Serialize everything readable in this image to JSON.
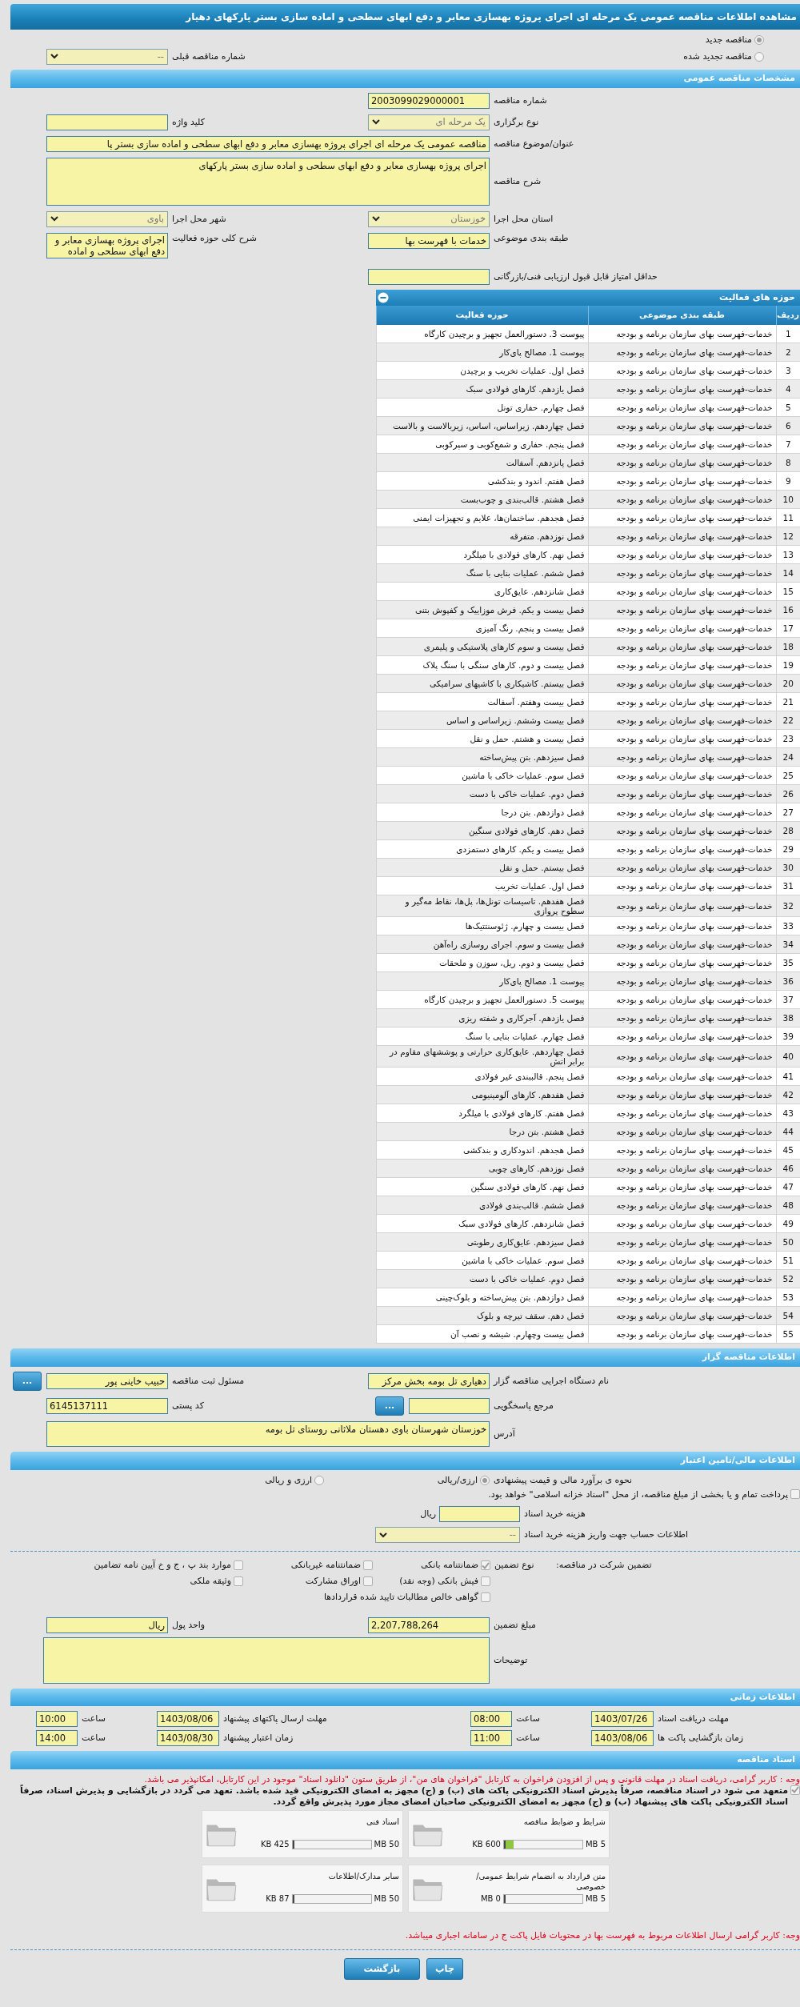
{
  "title": "مشاهده اطلاعات مناقصه عمومی یک مرحله ای اجرای پروژه بهسازی معابر و دفع ابهای سطحی و اماده سازی بستر پارکهای دهیار",
  "tender_kind": [
    {
      "label": "مناقصه جدید",
      "selected": true
    },
    {
      "label": "مناقصه تجدید شده",
      "selected": false
    }
  ],
  "previous_tender": {
    "label": "شماره مناقصه قبلی",
    "value": "--"
  },
  "general": {
    "header": "مشخصات مناقصه عمومی",
    "tender_number": {
      "label": "شماره مناقصه",
      "value": "2003099029000001"
    },
    "holding_type": {
      "label": "نوع برگزاری",
      "value": "یک مرحله ای"
    },
    "keyword": {
      "label": "کلید واژه"
    },
    "subject": {
      "label": "عنوان/موضوع مناقصه",
      "value": "مناقصه عمومی یک مرحله ای اجرای پروژه بهسازی معابر و دفع ابهای سطحی و اماده سازی بستر پا"
    },
    "description": {
      "label": "شرح مناقصه",
      "value": "اجرای پروژه بهسازی معابر و دفع ابهای سطحی و اماده سازی بستر پارکهای"
    },
    "province": {
      "label": "استان محل اجرا",
      "value": "خوزستان"
    },
    "city": {
      "label": "شهر محل اجرا",
      "value": "باوی"
    },
    "category": {
      "label": "طبقه بندی موضوعی",
      "value": "خدمات با فهرست بها"
    },
    "activity_summary": {
      "label": "شرح کلی حوزه فعالیت",
      "value": "اجرای پروژه بهسازی معابر و دفع ابهای سطحی و اماده"
    },
    "min_score": {
      "label": "حداقل امتیاز قابل قبول ارزیابی فنی/بازرگانی"
    }
  },
  "activities": {
    "header": "حوزه های فعالیت",
    "columns": [
      "ردیف",
      "طبقه بندی موضوعی",
      "حوزه فعالیت"
    ],
    "rows": [
      [
        "1",
        "خدمات-فهرست بهای سازمان برنامه و بودجه",
        "پیوست 3. دستورالعمل تجهیز و برچیدن کارگاه"
      ],
      [
        "2",
        "خدمات-فهرست بهای سازمان برنامه و بودجه",
        "پیوست 1. مصالح پای‌کار"
      ],
      [
        "3",
        "خدمات-فهرست بهای سازمان برنامه و بودجه",
        "فصل اول. عملیات تخریب و برچیدن"
      ],
      [
        "4",
        "خدمات-فهرست بهای سازمان برنامه و بودجه",
        "فصل یازدهم. کارهای فولادی سبک"
      ],
      [
        "5",
        "خدمات-فهرست بهای سازمان برنامه و بودجه",
        "فصل چهارم. حفاری تونل"
      ],
      [
        "6",
        "خدمات-فهرست بهای سازمان برنامه و بودجه",
        "فصل چهاردهم. زیراساس، اساس، زیربالاست و بالاست"
      ],
      [
        "7",
        "خدمات-فهرست بهای سازمان برنامه و بودجه",
        "فصل پنجم. حفاری و شمع‌کوبی و سپرکوبی"
      ],
      [
        "8",
        "خدمات-فهرست بهای سازمان برنامه و بودجه",
        "فصل پانزدهم. آسفالت"
      ],
      [
        "9",
        "خدمات-فهرست بهای سازمان برنامه و بودجه",
        "فصل هفتم. اندود و بندکشی"
      ],
      [
        "10",
        "خدمات-فهرست بهای سازمان برنامه و بودجه",
        "فصل هشتم. قالب‌بندی و چوب‌بست"
      ],
      [
        "11",
        "خدمات-فهرست بهای سازمان برنامه و بودجه",
        "فصل هجدهم. ساختمان‌ها، علایم و تجهیزات ایمنی"
      ],
      [
        "12",
        "خدمات-فهرست بهای سازمان برنامه و بودجه",
        "فصل نوزدهم. متفرقه"
      ],
      [
        "13",
        "خدمات-فهرست بهای سازمان برنامه و بودجه",
        "فصل نهم. کارهای فولادی با میلگرد"
      ],
      [
        "14",
        "خدمات-فهرست بهای سازمان برنامه و بودجه",
        "فصل ششم. عملیات بنایی با سنگ"
      ],
      [
        "15",
        "خدمات-فهرست بهای سازمان برنامه و بودجه",
        "فصل شانزدهم. عایق‌کاری"
      ],
      [
        "16",
        "خدمات-فهرست بهای سازمان برنامه و بودجه",
        "فصل بیست و یکم. فرش موزاییک و کفپوش بتنی"
      ],
      [
        "17",
        "خدمات-فهرست بهای سازمان برنامه و بودجه",
        "فصل بیست و پنجم. رنگ آمیزی"
      ],
      [
        "18",
        "خدمات-فهرست بهای سازمان برنامه و بودجه",
        "فصل بیست و سوم کارهای پلاستیکی و پلیمری"
      ],
      [
        "19",
        "خدمات-فهرست بهای سازمان برنامه و بودجه",
        "فصل بیست و دوم. کارهای سنگی با سنگ پلاک"
      ],
      [
        "20",
        "خدمات-فهرست بهای سازمان برنامه و بودجه",
        "فصل بیستم. کاشیکاری با کاشیهای سرامیکی"
      ],
      [
        "21",
        "خدمات-فهرست بهای سازمان برنامه و بودجه",
        "فصل بیست وهفتم. آسفالت"
      ],
      [
        "22",
        "خدمات-فهرست بهای سازمان برنامه و بودجه",
        "فصل بیست وششم. زیراساس و اساس"
      ],
      [
        "23",
        "خدمات-فهرست بهای سازمان برنامه و بودجه",
        "فصل بیست و هشتم. حمل و نقل"
      ],
      [
        "24",
        "خدمات-فهرست بهای سازمان برنامه و بودجه",
        "فصل سیزدهم. بتن پیش‌ساخته"
      ],
      [
        "25",
        "خدمات-فهرست بهای سازمان برنامه و بودجه",
        "فصل سوم. عملیات خاکی با ماشین"
      ],
      [
        "26",
        "خدمات-فهرست بهای سازمان برنامه و بودجه",
        "فصل دوم. عملیات خاکی با دست"
      ],
      [
        "27",
        "خدمات-فهرست بهای سازمان برنامه و بودجه",
        "فصل دوازدهم. بتن درجا"
      ],
      [
        "28",
        "خدمات-فهرست بهای سازمان برنامه و بودجه",
        "فصل دهم. کارهای فولادی سنگین"
      ],
      [
        "29",
        "خدمات-فهرست بهای سازمان برنامه و بودجه",
        "فصل بیست و یکم. کارهای دستمزدی"
      ],
      [
        "30",
        "خدمات-فهرست بهای سازمان برنامه و بودجه",
        "فصل بیستم. حمل و نقل"
      ],
      [
        "31",
        "خدمات-فهرست بهای سازمان برنامه و بودجه",
        "فصل اول. عملیات تخریب"
      ],
      [
        "32",
        "خدمات-فهرست بهای سازمان برنامه و بودجه",
        "فصل هفدهم. تاسیسات تونل‌ها، پل‌ها، نقاط مه‌گیر و سطوح پروازی"
      ],
      [
        "33",
        "خدمات-فهرست بهای سازمان برنامه و بودجه",
        "فصل بیست و چهارم. ژئوسنتتیک‌ها"
      ],
      [
        "34",
        "خدمات-فهرست بهای سازمان برنامه و بودجه",
        "فصل بیست و سوم. اجرای روسازی راه‌آهن"
      ],
      [
        "35",
        "خدمات-فهرست بهای سازمان برنامه و بودجه",
        "فصل بیست و دوم. ریل، سوزن و ملحقات"
      ],
      [
        "36",
        "خدمات-فهرست بهای سازمان برنامه و بودجه",
        "پیوست 1. مصالح پای‌کار"
      ],
      [
        "37",
        "خدمات-فهرست بهای سازمان برنامه و بودجه",
        "پیوست 5. دستورالعمل تجهیز و برچیدن کارگاه"
      ],
      [
        "38",
        "خدمات-فهرست بهای سازمان برنامه و بودجه",
        "فصل یازدهم. آجرکاری و شفته ریزی"
      ],
      [
        "39",
        "خدمات-فهرست بهای سازمان برنامه و بودجه",
        "فصل چهارم. عملیات بنایی با سنگ"
      ],
      [
        "40",
        "خدمات-فهرست بهای سازمان برنامه و بودجه",
        "فصل چهاردهم. عایق‌کاری حرارتی و پوششهای مقاوم در برابر اتش"
      ],
      [
        "41",
        "خدمات-فهرست بهای سازمان برنامه و بودجه",
        "فصل پنجم. قالببندی غیر فولادی"
      ],
      [
        "42",
        "خدمات-فهرست بهای سازمان برنامه و بودجه",
        "فصل هفدهم. کارهای آلومینیومی"
      ],
      [
        "43",
        "خدمات-فهرست بهای سازمان برنامه و بودجه",
        "فصل هفتم. کارهای فولادی با میلگرد"
      ],
      [
        "44",
        "خدمات-فهرست بهای سازمان برنامه و بودجه",
        "فصل هشتم. بتن درجا"
      ],
      [
        "45",
        "خدمات-فهرست بهای سازمان برنامه و بودجه",
        "فصل هجدهم. اندودکاری و بندکشی"
      ],
      [
        "46",
        "خدمات-فهرست بهای سازمان برنامه و بودجه",
        "فصل نوزدهم. کارهای چوبی"
      ],
      [
        "47",
        "خدمات-فهرست بهای سازمان برنامه و بودجه",
        "فصل نهم. کارهای فولادی سنگین"
      ],
      [
        "48",
        "خدمات-فهرست بهای سازمان برنامه و بودجه",
        "فصل ششم. قالب‌بندی فولادی"
      ],
      [
        "49",
        "خدمات-فهرست بهای سازمان برنامه و بودجه",
        "فصل شانزدهم. کارهای فولادی سبک"
      ],
      [
        "50",
        "خدمات-فهرست بهای سازمان برنامه و بودجه",
        "فصل سیزدهم. عایق‌کاری رطوبتی"
      ],
      [
        "51",
        "خدمات-فهرست بهای سازمان برنامه و بودجه",
        "فصل سوم. عملیات خاکی با ماشین"
      ],
      [
        "52",
        "خدمات-فهرست بهای سازمان برنامه و بودجه",
        "فصل دوم. عملیات خاکی با دست"
      ],
      [
        "53",
        "خدمات-فهرست بهای سازمان برنامه و بودجه",
        "فصل دوازدهم. بتن پیش‌ساخته و بلوک‌چینی"
      ],
      [
        "54",
        "خدمات-فهرست بهای سازمان برنامه و بودجه",
        "فصل دهم. سقف تیرچه و بلوک"
      ],
      [
        "55",
        "خدمات-فهرست بهای سازمان برنامه و بودجه",
        "فصل بیست وچهارم. شیشه و نصب آن"
      ]
    ]
  },
  "tenderer": {
    "header": "اطلاعات مناقصه گزار",
    "organization": {
      "label": "نام دستگاه اجرایی مناقصه گزار",
      "value": "دهیاری تل بومه بخش مرکز"
    },
    "registrar": {
      "label": "مسئول ثبت مناقصه",
      "value": "حبیب خاینی پور",
      "button": "..."
    },
    "responder": {
      "label": "مرجع پاسخگویی",
      "button": "..."
    },
    "postal_code": {
      "label": "کد پستی",
      "value": "6145137111"
    },
    "address": {
      "label": "آدرس",
      "value": "خوزستان شهرستان باوی دهستان ملاثانی روستای تل بومه"
    }
  },
  "finance": {
    "header": "اطلاعات مالی/تامین اعتبار",
    "estimate": {
      "label": "نحوه ی برآورد مالی و قیمت پیشنهادی",
      "options": [
        {
          "label": "ارزی/ریالی",
          "selected": true
        },
        {
          "label": "ارزی و ریالی",
          "selected": false
        }
      ]
    },
    "islamic_treasury": {
      "label": "پرداخت تمام و یا بخشی از مبلغ مناقصه، از محل \"اسناد خزانه اسلامی\" خواهد بود.",
      "checked": false
    },
    "document_fee": {
      "label": "هزینه خرید اسناد",
      "unit": "ریال"
    },
    "account": {
      "label": "اطلاعات حساب جهت واریز هزینه خرید اسناد",
      "value": "--"
    },
    "guarantee": {
      "title": "تضمین شرکت در مناقصه:",
      "type_label": "نوع تضمین",
      "options": [
        {
          "label": "ضمانتنامه بانکی",
          "checked": true
        },
        {
          "label": "ضمانتنامه غیربانکی",
          "checked": false
        },
        {
          "label": "موارد بند پ ، ج و خ آیین نامه تضامین",
          "checked": false
        },
        {
          "label": "فیش بانکی (وجه نقد)",
          "checked": false
        },
        {
          "label": "اوراق مشارکت",
          "checked": false
        },
        {
          "label": "وثیقه ملکی",
          "checked": false
        },
        {
          "label": "گواهی خالص مطالبات تایید شده قراردادها",
          "checked": false
        }
      ]
    },
    "amount": {
      "label": "مبلغ تضمین",
      "value": "2,207,788,264"
    },
    "currency": {
      "label": "واحد پول",
      "value": "ریال"
    },
    "notes": {
      "label": "توضیحات"
    }
  },
  "timing": {
    "header": "اطلاعات زمانی",
    "items": [
      {
        "label": "مهلت دریافت اسناد",
        "date": "1403/07/26",
        "time_label": "ساعت",
        "time": "08:00"
      },
      {
        "label": "مهلت ارسال پاکتهای پیشنهاد",
        "date": "1403/08/06",
        "time_label": "ساعت",
        "time": "10:00"
      },
      {
        "label": "زمان بازگشایی پاکت ها",
        "date": "1403/08/06",
        "time_label": "ساعت",
        "time": "11:00"
      },
      {
        "label": "زمان اعتبار پیشنهاد",
        "date": "1403/08/30",
        "time_label": "ساعت",
        "time": "14:00"
      }
    ]
  },
  "documents": {
    "header": "اسناد مناقصه",
    "notice": "وجه : کاربر گرامی، دریافت اسناد در مهلت قانونی و پس از افزودن فراخوان به کارتابل \"فراخوان های من\"، از طریق ستون \"دانلود اسناد\" موجود در این کارتابل، امکانپذیر می باشد.",
    "commitment": {
      "text": "متعهد می شود در اسناد مناقصه، صرفاً پذیرش اسناد الکترونیکی پاکت های (ب) و (ج) مجهز به امضای الکترونیکی قید شده باشد. تعهد می گردد در بازگشایی و پذیرش اسناد، صرفاً اسناد الکترونیکی پاکت های پیشنهاد (ب) و (ج) مجهز به امضای الکترونیکی صاحبان امضای مجاز مورد پذیرش واقع گردد.",
      "checked": true
    },
    "files": [
      {
        "title": "شرایط و ضوابط مناقصه",
        "max": "5 MB",
        "size": "600 KB",
        "level": 0.12
      },
      {
        "title": "اسناد فنی",
        "max": "50 MB",
        "size": "425 KB",
        "level": 0.01
      },
      {
        "title": "متن قرارداد به انضمام شرایط عمومی/خصوصی",
        "max": "5 MB",
        "size": "0 MB",
        "level": 0
      },
      {
        "title": "سایر مدارک/اطلاعات",
        "max": "50 MB",
        "size": "87 KB",
        "level": 0.002
      }
    ],
    "footer_note": "وجه: کاربر گرامی ارسال اطلاعات مربوط به فهرست بها در محتویات فایل پاکت ج در سامانه اجباری میباشد."
  },
  "buttons": [
    {
      "label": "چاپ"
    },
    {
      "label": "بازگشت"
    }
  ]
}
